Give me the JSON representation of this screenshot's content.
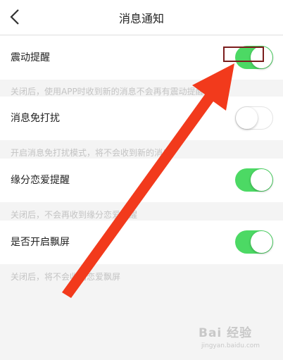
{
  "header": {
    "title": "消息通知"
  },
  "settings": [
    {
      "label": "震动提醒",
      "on": true,
      "hint": "关闭后，使用APP时收到新的消息不会再有震动提醒"
    },
    {
      "label": "消息免打扰",
      "on": false,
      "hint": "开启消息免打扰模式，将不会收到新的消息"
    },
    {
      "label": "缘分恋爱提醒",
      "on": true,
      "hint": "关闭后，不会再收到缘分恋爱提醒"
    },
    {
      "label": "是否开启飘屏",
      "on": true,
      "hint": "关闭后，将不会收到恋爱飘屏"
    }
  ],
  "colors": {
    "toggle_on": "#4cd964",
    "arrow": "#f23a1c",
    "highlight_box": "#7b1d1d"
  },
  "watermark": {
    "logo": "Bai 经验",
    "url": "jingyan.baidu.com"
  }
}
